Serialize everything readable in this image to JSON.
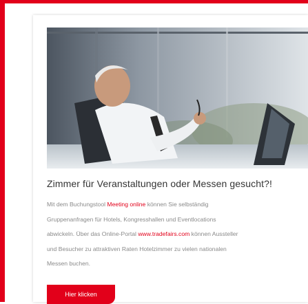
{
  "teaser": {
    "headline": "Zimmer für Veranstaltungen oder Messen gesucht?!",
    "body": {
      "line1_prefix": "Mit dem Buchungstool ",
      "line1_link": "Meeting online",
      "line1_suffix": " können Sie selbständig",
      "line2": "Gruppenanfragen für Hotels, Kongresshallen und Eventlocations",
      "line3_prefix": "abwickeln. Über das Online-Portal ",
      "line3_link": "www.tradefairs.com",
      "line3_suffix": " können Aussteller",
      "line4": "und Besucher zu attraktiven Raten Hotelzimmer zu vielen nationalen",
      "line5": "Messen buchen."
    },
    "cta_label": "Hier klicken"
  },
  "colors": {
    "accent": "#e2001a",
    "headline": "#333333",
    "body": "#8a8a8a"
  },
  "image": {
    "icon": "hero-photo-relaxed-businessman"
  }
}
